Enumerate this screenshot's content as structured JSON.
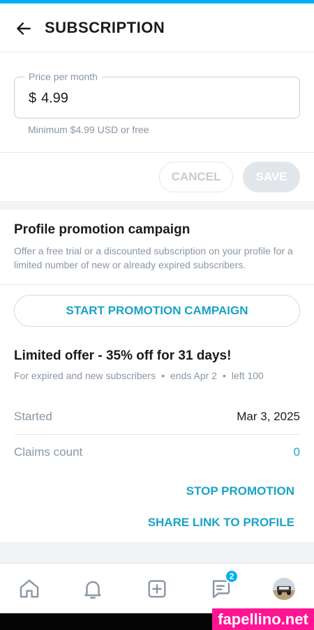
{
  "header": {
    "title": "SUBSCRIPTION"
  },
  "price": {
    "legend": "Price per month",
    "currency": "$",
    "value": "4.99",
    "hint": "Minimum $4.99 USD or free"
  },
  "actions": {
    "cancel_label": "CANCEL",
    "save_label": "SAVE"
  },
  "promotion": {
    "title": "Profile promotion campaign",
    "description": "Offer a free trial or a discounted subscription on your profile for a limited number of new or already expired subscribers.",
    "start_label": "START PROMOTION CAMPAIGN"
  },
  "offer": {
    "title": "Limited offer - 35% off for 31 days!",
    "audience": "For expired and new subscribers",
    "ends": "ends Apr 2",
    "left": "left 100",
    "separator": "•",
    "started_label": "Started",
    "started_value": "Mar 3, 2025",
    "claims_label": "Claims count",
    "claims_value": "0",
    "stop_label": "STOP PROMOTION",
    "share_label": "SHARE LINK TO PROFILE"
  },
  "bottom_nav": {
    "messages_badge": "2",
    "icons": [
      "home-icon",
      "bell-icon",
      "add-icon",
      "messages-icon",
      "avatar"
    ]
  },
  "watermark": {
    "text": "fapellino.net"
  },
  "colors": {
    "accent": "#00aff0",
    "link": "#1aa3c4",
    "muted_text": "#8a96a3",
    "watermark": "#ff1493"
  }
}
